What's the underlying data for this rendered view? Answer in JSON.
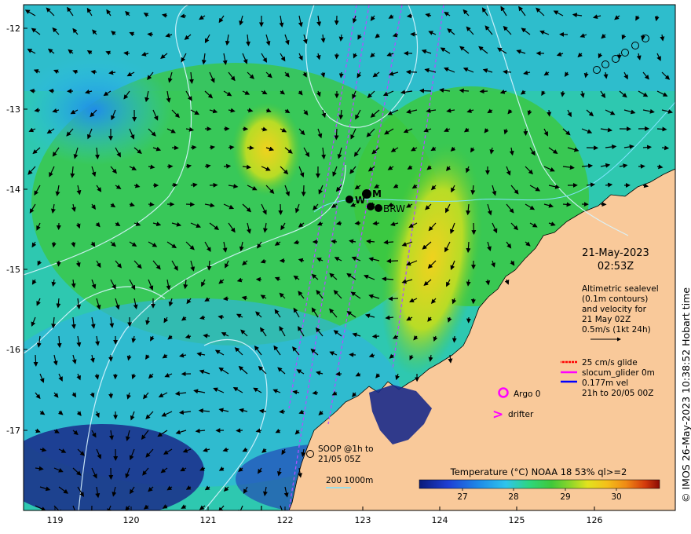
{
  "map": {
    "x_ticks": [
      "119",
      "120",
      "121",
      "122",
      "123",
      "124",
      "125",
      "126"
    ],
    "y_ticks": [
      "-12",
      "-13",
      "-14",
      "-15",
      "-16",
      "-17"
    ],
    "date": "21-May-2023",
    "time": "02:53Z",
    "altimetry_legend": [
      "Altimetric sealevel",
      "(0.1m contours)",
      "and velocity for",
      "21 May 02Z",
      "0.5m/s (1kt 24h)"
    ],
    "glider_legend": [
      "25 cm/s glide",
      "slocum_glider 0m",
      "0.177m vel",
      "21h to 20/05 00Z"
    ],
    "argo_label": "Argo 0",
    "drifter_label": "drifter",
    "drifter_symbol": ">",
    "soop_label": [
      "SOOP @1h to",
      "21/05 05Z"
    ],
    "depth_label": "200  1000m",
    "colorbar_title": "Temperature (°C) NOAA 18 53% ql>=2",
    "colorbar_ticks": [
      "27",
      "28",
      "29",
      "30"
    ],
    "mooring_labels": [
      "W",
      "BRW"
    ],
    "mooring_marker_letter": "M",
    "credit": "© IMOS 26-May-2023 10:38:52 Hobart time",
    "colors": {
      "land": "#f9c99a",
      "deep": "#1a2a8a",
      "argo": "#ff00ff",
      "glider_red": "#ff0000",
      "glider_magenta": "#ff00ff",
      "glider_blue": "#0000ff",
      "contour": "#d8f4ff"
    },
    "colormap": [
      "#0a1a7a",
      "#1f3fd4",
      "#1f8ce8",
      "#2fc4ec",
      "#2ed67c",
      "#3fc83a",
      "#8fd62a",
      "#e2e21e",
      "#f4c01a",
      "#f08a14",
      "#d43a0c",
      "#8a0a04"
    ]
  }
}
